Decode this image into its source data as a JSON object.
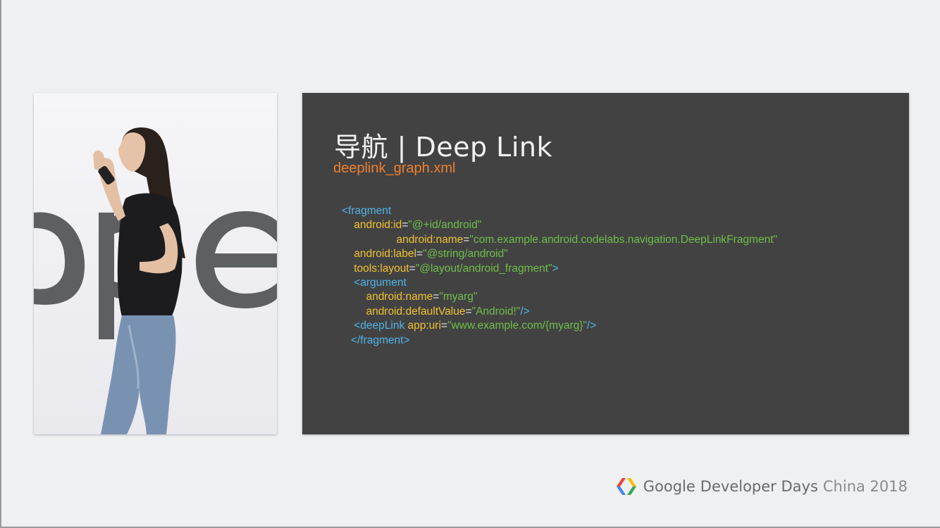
{
  "slide": {
    "title": "导航 | Deep Link",
    "filename": "deeplink_graph.xml",
    "code_lines": [
      [
        {
          "t": "tag",
          "s": "<fragment"
        }
      ],
      [
        {
          "t": "attr",
          "s": "    android:id"
        },
        {
          "t": "eq",
          "s": "="
        },
        {
          "t": "val",
          "s": "\"@+id/android\""
        }
      ],
      [
        {
          "t": "attr",
          "s": "                  android:name"
        },
        {
          "t": "eq",
          "s": "="
        },
        {
          "t": "val",
          "s": "\"com.example.android.codelabs.navigation.DeepLinkFragment\""
        }
      ],
      [
        {
          "t": "attr",
          "s": "    android:label"
        },
        {
          "t": "eq",
          "s": "="
        },
        {
          "t": "val",
          "s": "\"@string/android\""
        }
      ],
      [
        {
          "t": "attr",
          "s": "    tools:layout"
        },
        {
          "t": "eq",
          "s": "="
        },
        {
          "t": "val",
          "s": "\"@layout/android_fragment\""
        },
        {
          "t": "tag",
          "s": ">"
        }
      ],
      [
        {
          "t": "tag",
          "s": "    <argument"
        }
      ],
      [
        {
          "t": "attr",
          "s": "        android:name"
        },
        {
          "t": "eq",
          "s": "="
        },
        {
          "t": "val",
          "s": "\"myarg\""
        }
      ],
      [
        {
          "t": "attr",
          "s": "        android:defaultValue"
        },
        {
          "t": "eq",
          "s": "="
        },
        {
          "t": "val",
          "s": "\"Android!\""
        },
        {
          "t": "tag",
          "s": "/>"
        }
      ],
      [
        {
          "t": "tag",
          "s": "    <deepLink "
        },
        {
          "t": "attr",
          "s": "app:uri"
        },
        {
          "t": "eq",
          "s": "="
        },
        {
          "t": "val",
          "s": "\"www.example.com/{myarg}\""
        },
        {
          "t": "tag",
          "s": "/>"
        }
      ],
      [
        {
          "t": "tag",
          "s": "   </fragment>"
        }
      ]
    ]
  },
  "footer": {
    "brand_google": "Google",
    "brand_event": "Developer Days",
    "brand_location": "China 2018"
  },
  "colors": {
    "slide_bg": "#424242",
    "filename": "#f0802e",
    "tag": "#4fb3e8",
    "attribute": "#f1c232",
    "value": "#6fbf4a",
    "logo_red": "#ea4335",
    "logo_blue": "#4285f4",
    "logo_green": "#34a853",
    "logo_yellow": "#fbbc05"
  },
  "video": {
    "backdrop_letters": "ope"
  }
}
